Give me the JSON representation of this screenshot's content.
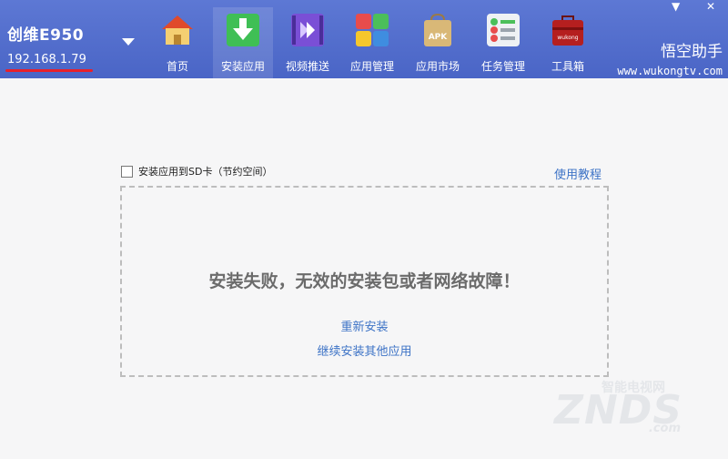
{
  "device": {
    "name": "创维E950",
    "ip": "192.168.1.79"
  },
  "window_controls": {
    "minimize": "▼",
    "close": "✕"
  },
  "nav": [
    {
      "label": "首页",
      "icon": "home-icon"
    },
    {
      "label": "安装应用",
      "icon": "install-download-icon",
      "active": true
    },
    {
      "label": "视频推送",
      "icon": "video-push-icon"
    },
    {
      "label": "应用管理",
      "icon": "app-management-icon"
    },
    {
      "label": "应用市场",
      "icon": "app-market-apk-icon",
      "icon_text": "APK"
    },
    {
      "label": "任务管理",
      "icon": "task-management-icon"
    },
    {
      "label": "工具箱",
      "icon": "toolbox-icon",
      "icon_text": "wukong"
    }
  ],
  "brand": {
    "name": "悟空助手",
    "url": "www.wukongtv.com"
  },
  "install": {
    "sd_checkbox_label": "安装应用到SD卡（节约空间）",
    "tutorial_link": "使用教程",
    "error_message": "安装失败，无效的安装包或者网络故障！",
    "reinstall_link": "重新安装",
    "continue_link": "继续安装其他应用"
  },
  "watermark": {
    "main": "ZNDS",
    "domain": ".com",
    "cn": "智能电视网"
  },
  "colors": {
    "topbar": "#4a65c6",
    "link": "#3d73c6",
    "error_text": "#6b6b6b",
    "accent_red": "#e8202a"
  }
}
